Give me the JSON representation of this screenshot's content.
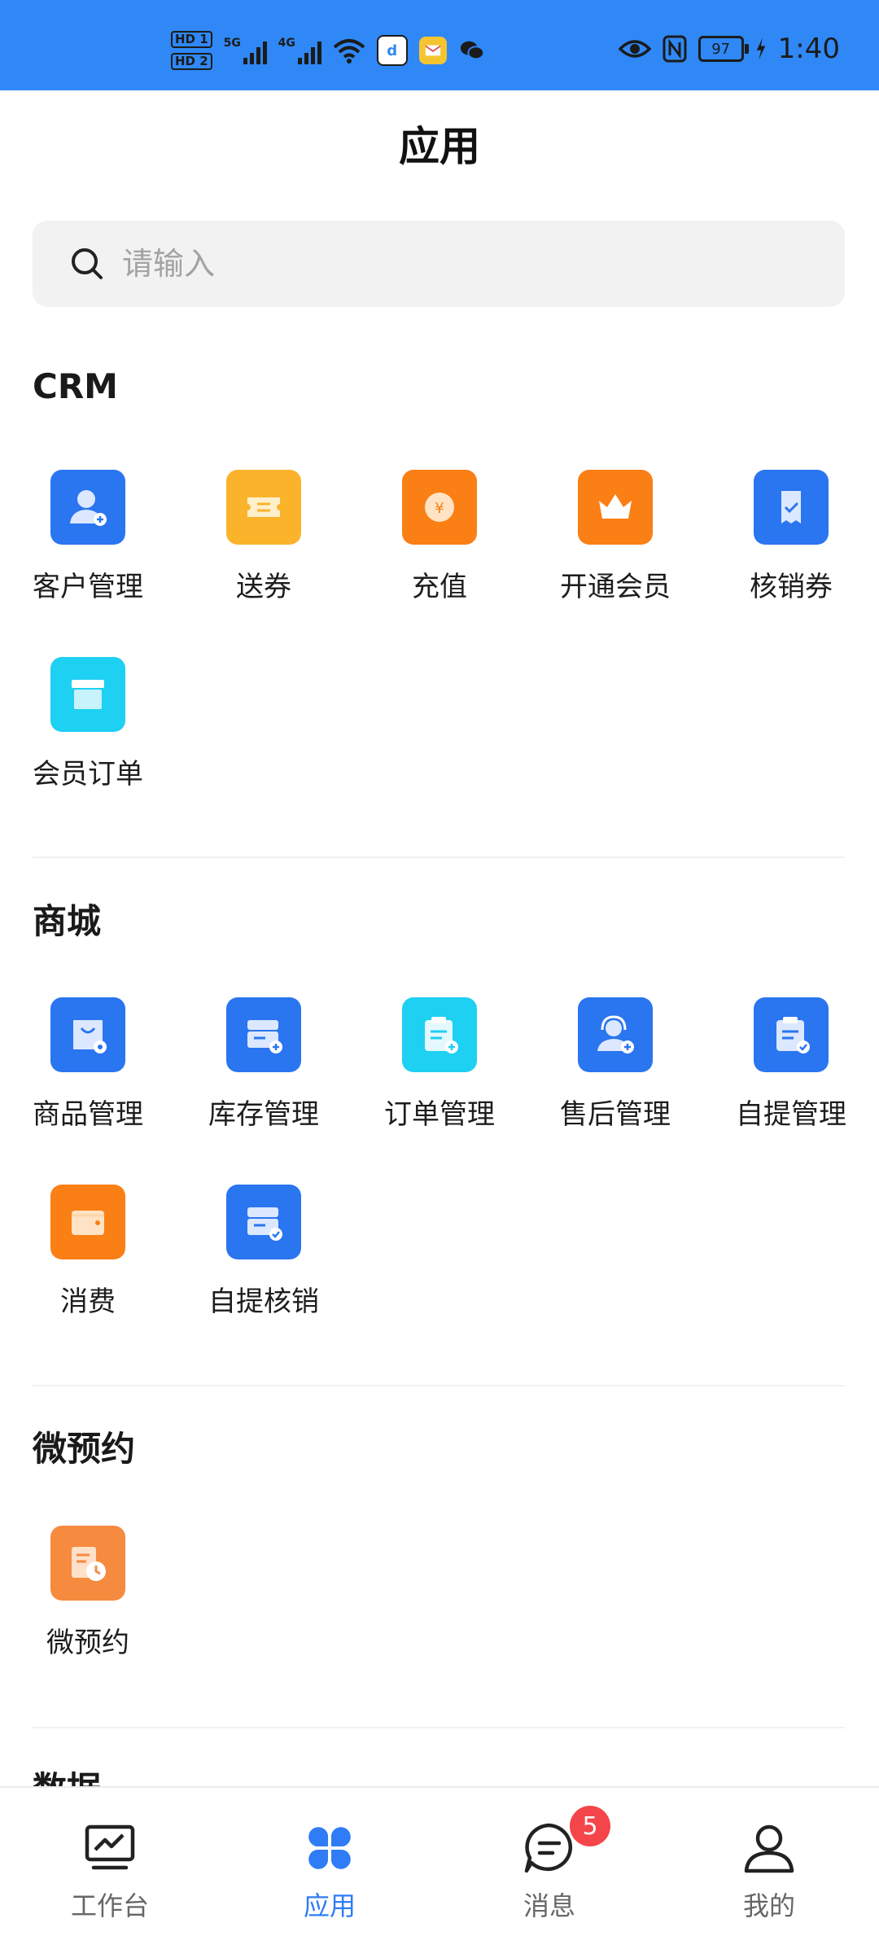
{
  "status_bar": {
    "sim1": "HD 1",
    "sim2": "HD 2",
    "net1": "5G",
    "net2": "4G",
    "battery": "97",
    "time": "1:40",
    "icons": [
      "wifi-icon",
      "app-d-icon",
      "mail-icon",
      "wechat-icon",
      "eye-icon",
      "nfc-icon",
      "charging-icon"
    ]
  },
  "header": {
    "title": "应用"
  },
  "search": {
    "placeholder": "请输入"
  },
  "sections": [
    {
      "title": "CRM",
      "items": [
        {
          "label": "客户管理",
          "icon": "customer-icon",
          "color": "#2a75f0"
        },
        {
          "label": "送券",
          "icon": "ticket-icon",
          "color": "#fbb32c"
        },
        {
          "label": "充值",
          "icon": "coin-icon",
          "color": "#fa7f14"
        },
        {
          "label": "开通会员",
          "icon": "crown-icon",
          "color": "#fa7f14"
        },
        {
          "label": "核销券",
          "icon": "verify-coupon-icon",
          "color": "#2a75f0"
        },
        {
          "label": "会员订单",
          "icon": "box-icon",
          "color": "#1ed0f2"
        }
      ]
    },
    {
      "title": "商城",
      "items": [
        {
          "label": "商品管理",
          "icon": "shopping-bag-icon",
          "color": "#2a75f0"
        },
        {
          "label": "库存管理",
          "icon": "inventory-icon",
          "color": "#2a75f0"
        },
        {
          "label": "订单管理",
          "icon": "clipboard-icon",
          "color": "#1ed0f2"
        },
        {
          "label": "售后管理",
          "icon": "headset-icon",
          "color": "#2a75f0"
        },
        {
          "label": "自提管理",
          "icon": "pickup-icon",
          "color": "#2a75f0"
        },
        {
          "label": "消费",
          "icon": "wallet-icon",
          "color": "#fa7f14"
        },
        {
          "label": "自提核销",
          "icon": "pickup-verify-icon",
          "color": "#2a75f0"
        }
      ]
    },
    {
      "title": "微预约",
      "items": [
        {
          "label": "微预约",
          "icon": "appointment-icon",
          "color": "#f68a3f"
        }
      ]
    },
    {
      "title": "数据",
      "items": []
    }
  ],
  "bottom_nav": [
    {
      "label": "工作台",
      "icon": "dashboard-icon",
      "active": false
    },
    {
      "label": "应用",
      "icon": "apps-icon",
      "active": true
    },
    {
      "label": "消息",
      "icon": "message-icon",
      "active": false,
      "badge": "5"
    },
    {
      "label": "我的",
      "icon": "profile-icon",
      "active": false
    }
  ],
  "colors": {
    "accent": "#2f7cf6",
    "status_bar": "#2f88f5",
    "badge": "#f4454a"
  }
}
